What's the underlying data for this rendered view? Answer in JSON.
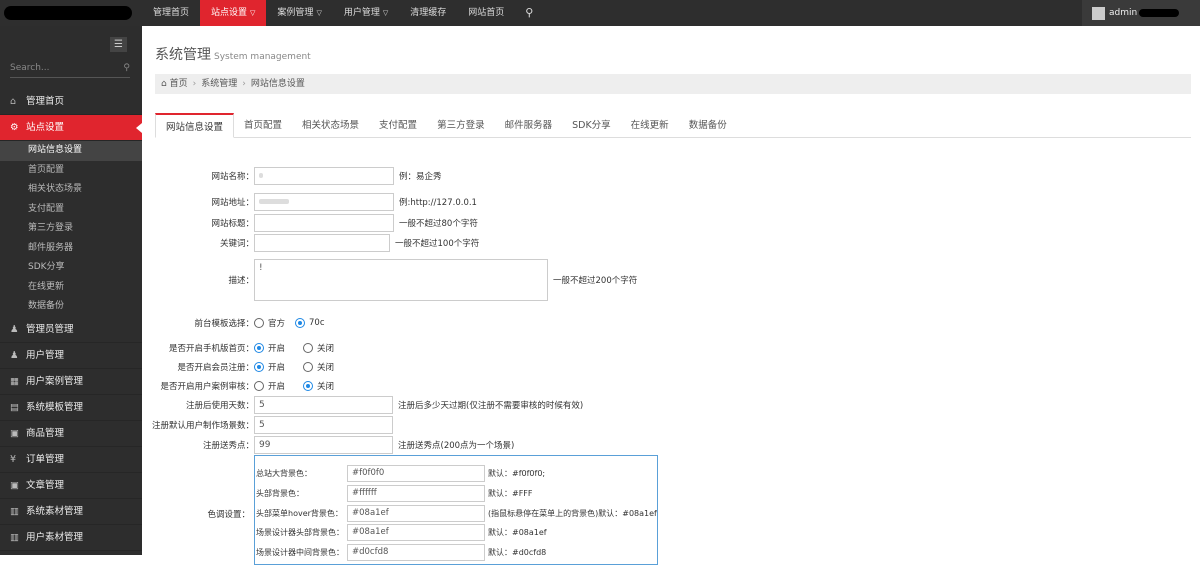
{
  "topnav": {
    "items": [
      {
        "label": "管理首页",
        "active": false,
        "caret": false
      },
      {
        "label": "站点设置",
        "active": true,
        "caret": true
      },
      {
        "label": "案例管理",
        "active": false,
        "caret": true
      },
      {
        "label": "用户管理",
        "active": false,
        "caret": true
      },
      {
        "label": "清理缓存",
        "active": false,
        "caret": false
      },
      {
        "label": "网站首页",
        "active": false,
        "caret": false
      }
    ],
    "search_icon": "search-icon",
    "user_name": "admin"
  },
  "sidebar": {
    "search_placeholder": "Search...",
    "menu": [
      {
        "label": "管理首页",
        "icon": "home-icon",
        "glyph": "⌂"
      },
      {
        "label": "站点设置",
        "icon": "gears-icon",
        "glyph": "⚙",
        "active": true
      }
    ],
    "submenu": [
      "网站信息设置",
      "首页配置",
      "相关状态场景",
      "支付配置",
      "第三方登录",
      "邮件服务器",
      "SDK分享",
      "在线更新",
      "数据备份"
    ],
    "menu_after": [
      {
        "label": "管理员管理",
        "icon": "user-icon",
        "glyph": "♟"
      },
      {
        "label": "用户管理",
        "icon": "user-icon",
        "glyph": "♟"
      },
      {
        "label": "用户案例管理",
        "icon": "table-icon",
        "glyph": "▦"
      },
      {
        "label": "系统模板管理",
        "icon": "briefcase-icon",
        "glyph": "▤"
      },
      {
        "label": "商品管理",
        "icon": "square-icon",
        "glyph": "▣"
      },
      {
        "label": "订单管理",
        "icon": "yen-icon",
        "glyph": "¥"
      },
      {
        "label": "文章管理",
        "icon": "square-icon",
        "glyph": "▣"
      },
      {
        "label": "系统素材管理",
        "icon": "gift-icon",
        "glyph": "▥"
      },
      {
        "label": "用户素材管理",
        "icon": "gift-icon",
        "glyph": "▥"
      }
    ]
  },
  "page": {
    "title": "系统管理",
    "subtitle": "System management",
    "breadcrumb": [
      "首页",
      "系统管理",
      "网站信息设置"
    ]
  },
  "tabs": [
    "网站信息设置",
    "首页配置",
    "相关状态场景",
    "支付配置",
    "第三方登录",
    "邮件服务器",
    "SDK分享",
    "在线更新",
    "数据备份"
  ],
  "form": {
    "site_name_label": "网站名称：",
    "site_name_hint": "例：易企秀",
    "site_url_label": "网站地址：",
    "site_url_hint": "例:http://127.0.0.1",
    "site_title_label": "网站标题：",
    "site_title_hint": "一般不超过80个字符",
    "keywords_label": "关键词：",
    "keywords_hint": "一般不超过100个字符",
    "desc_label": "描述：",
    "desc_value": "!",
    "desc_hint": "一般不超过200个字符",
    "template_label": "前台模板选择：",
    "template_opt1": "官方",
    "template_opt2": "70c",
    "mobile_label": "是否开启手机版首页：",
    "member_label": "是否开启会员注册：",
    "review_label": "是否开启用户案例审核：",
    "on": "开启",
    "off": "关闭",
    "days_label": "注册后使用天数：",
    "days_value": "5",
    "days_hint": "注册后多少天过期(仅注册不需要审核的时候有效)",
    "scenes_label": "注册默认用户制作场景数：",
    "scenes_value": "5",
    "points_label": "注册送秀点：",
    "points_value": "99",
    "points_hint": "注册送秀点(200点为一个场景)",
    "color_label": "色调设置：",
    "colors": [
      {
        "label": "总站大背景色：",
        "value": "#f0f0f0",
        "hint": "默认：#f0f0f0;"
      },
      {
        "label": "头部背景色：",
        "value": "#ffffff",
        "hint": "默认：#FFF"
      },
      {
        "label": "头部菜单hover背景色：",
        "value": "#08a1ef",
        "hint": "(指鼠标悬停在菜单上的背景色)默认：#08a1ef"
      },
      {
        "label": "场景设计器头部背景色：",
        "value": "#08a1ef",
        "hint": "默认：#08a1ef"
      },
      {
        "label": "场景设计器中间背景色：",
        "value": "#d0cfd8",
        "hint": "默认：#d0cfd8"
      }
    ]
  },
  "colors": {
    "accent": "#e0252e",
    "topbar": "#2e2e2e",
    "sidebar": "#2d2d2d",
    "radio": "#1e88e5"
  }
}
